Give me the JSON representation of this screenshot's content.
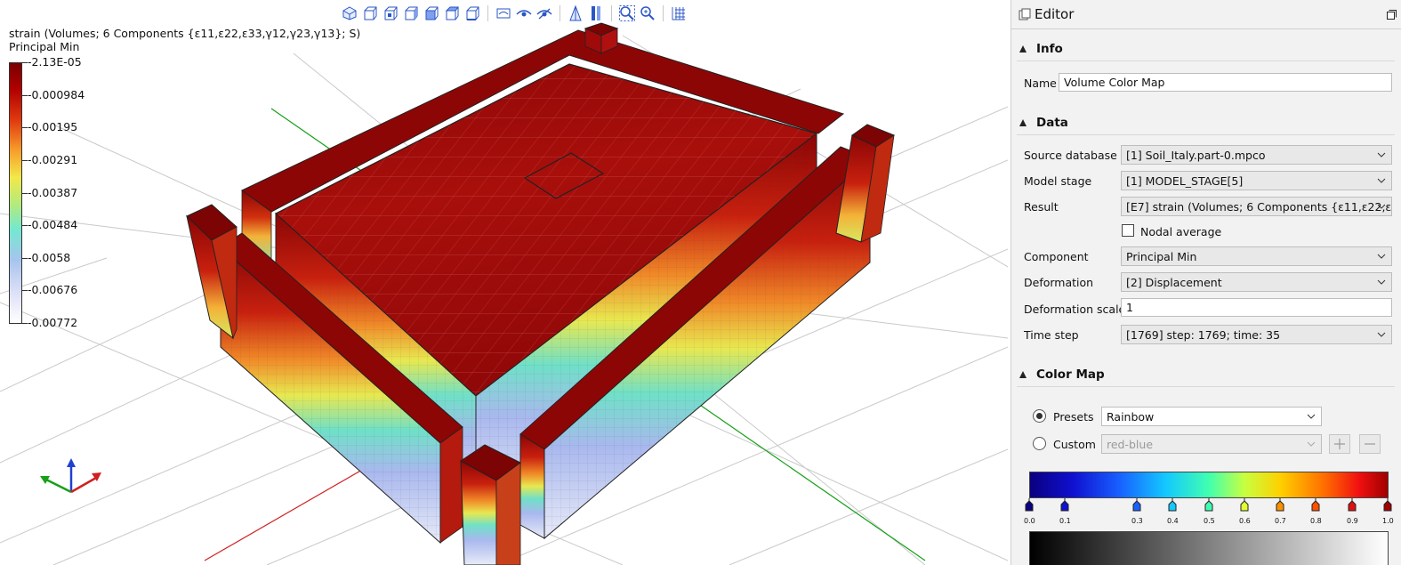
{
  "viewport": {
    "legend": {
      "title_line1": "strain (Volumes; 6 Components {ε11,ε22,ε33,γ12,γ23,γ13}; S)",
      "title_line2": "Principal Min",
      "ticks": [
        "-2.13E-05",
        "-0.000984",
        "-0.00195",
        "-0.00291",
        "-0.00387",
        "-0.00484",
        "-0.0058",
        "-0.00676",
        "-0.00772"
      ]
    },
    "toolbar_icons": [
      "iso-view-icon",
      "view-front-icon",
      "view-back-icon",
      "view-left-icon",
      "view-right-icon",
      "view-top-icon",
      "view-bottom-icon",
      "show-edges-icon",
      "eye-icon",
      "hide-icon",
      "perspective-icon",
      "clip-icon",
      "zoom-fit-icon",
      "zoom-icon",
      "grid-icon"
    ],
    "axis_colors": {
      "x": "#d02020",
      "y": "#18a018",
      "z": "#2040d0"
    }
  },
  "editor": {
    "title": "Editor",
    "info": {
      "section": "Info",
      "name_label": "Name",
      "name_value": "Volume Color Map"
    },
    "data": {
      "section": "Data",
      "source_database_label": "Source database",
      "source_database_value": "[1] Soil_Italy.part-0.mpco",
      "model_stage_label": "Model stage",
      "model_stage_value": "[1] MODEL_STAGE[5]",
      "result_label": "Result",
      "result_value": "[E7] strain (Volumes; 6 Components {ε11,ε22,ε3",
      "nodal_average_label": "Nodal average",
      "component_label": "Component",
      "component_value": "Principal Min",
      "deformation_label": "Deformation",
      "deformation_value": "[2] Displacement",
      "deformation_scale_label": "Deformation scale",
      "deformation_scale_value": "1",
      "time_step_label": "Time step",
      "time_step_value": "[1769] step: 1769; time: 35"
    },
    "color_map": {
      "section": "Color Map",
      "presets_label": "Presets",
      "presets_value": "Rainbow",
      "custom_label": "Custom",
      "custom_value": "red-blue",
      "stop_labels": [
        "0.0",
        "0.1",
        "0.3",
        "0.4",
        "0.5",
        "0.6",
        "0.7",
        "0.8",
        "0.9",
        "1.0"
      ],
      "stop_colors": [
        "#0a0080",
        "#1010d0",
        "#1860ff",
        "#14c8ff",
        "#40ffb0",
        "#e0ff30",
        "#ff9000",
        "#ff5000",
        "#e01010",
        "#a00000"
      ]
    }
  }
}
